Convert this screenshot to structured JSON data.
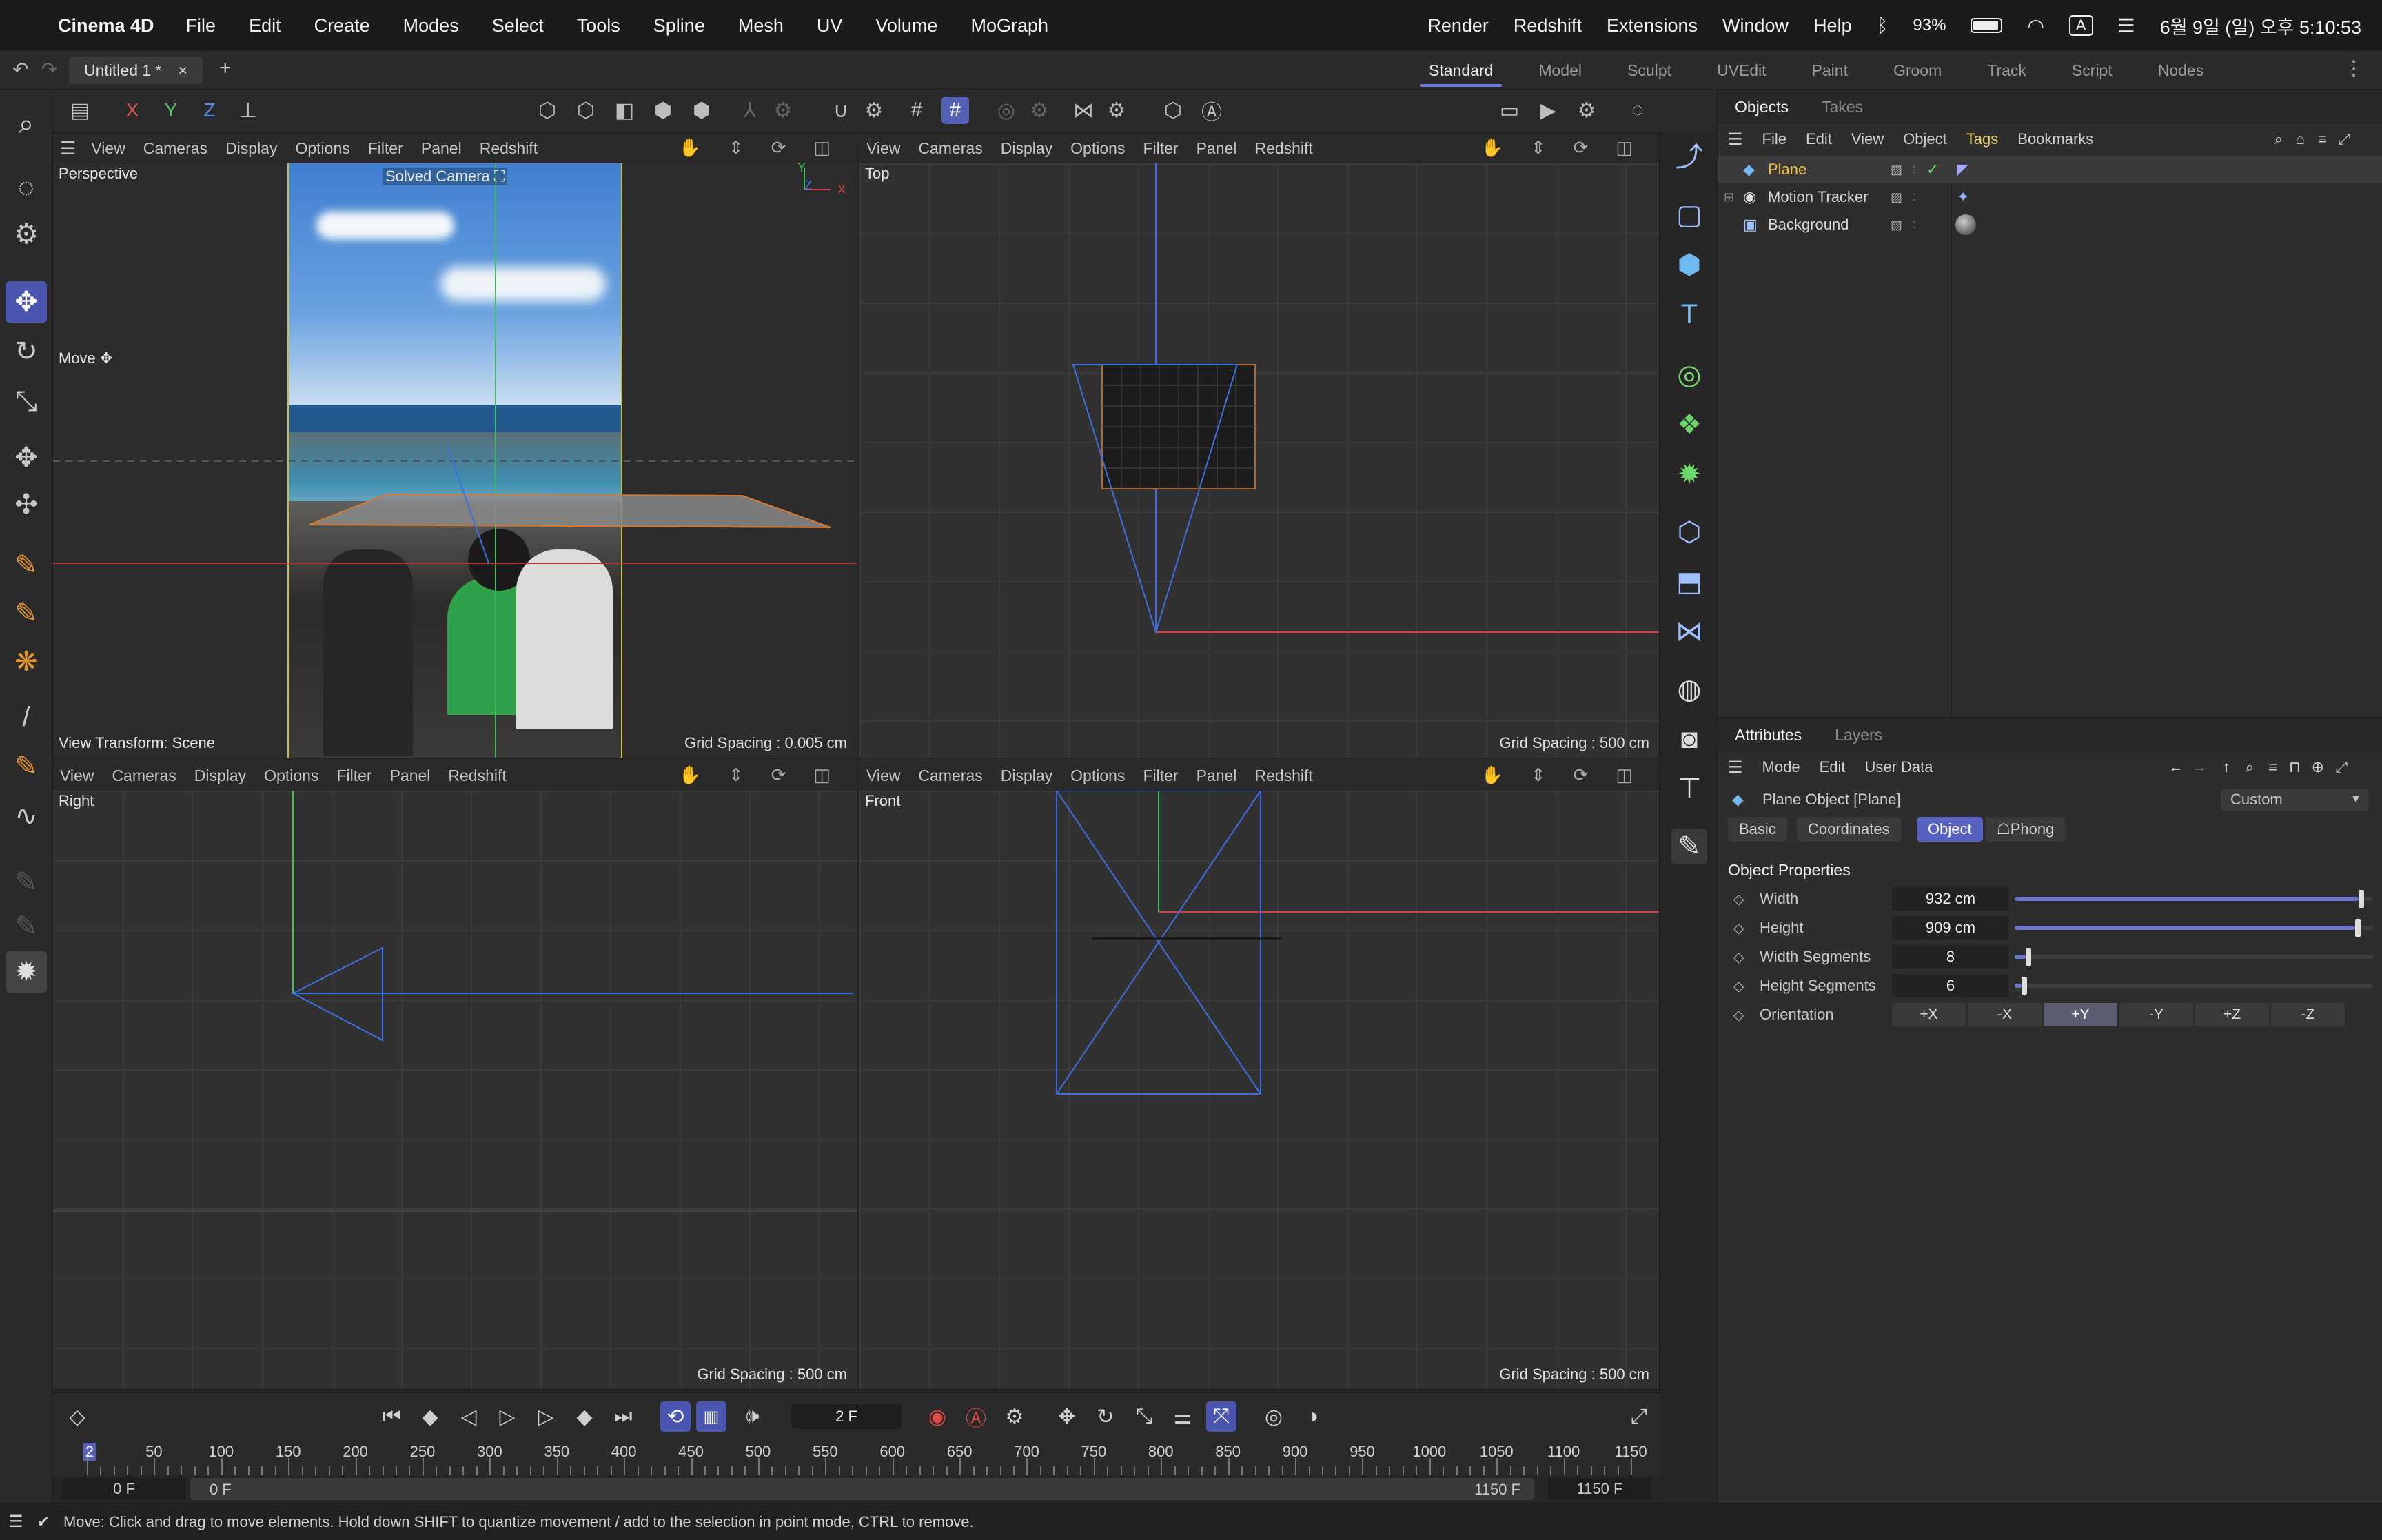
{
  "menubar": {
    "app_name": "Cinema 4D",
    "items": [
      "File",
      "Edit",
      "Create",
      "Modes",
      "Select",
      "Tools",
      "Spline",
      "Mesh",
      "UV",
      "Volume",
      "MoGraph"
    ],
    "right_items": [
      "Render",
      "Redshift",
      "Extensions",
      "Window",
      "Help"
    ],
    "battery": "93%",
    "input_source": "A",
    "datetime": "6월 9일 (일) 오후 5:10:53"
  },
  "document": {
    "tab_title": "Untitled 1 *",
    "close": "×",
    "new_tab": "+"
  },
  "layouts": {
    "items": [
      "Standard",
      "Model",
      "Sculpt",
      "UVEdit",
      "Paint",
      "Groom",
      "Track",
      "Script",
      "Nodes"
    ],
    "active": "Standard"
  },
  "toolbar": {
    "axis_x": "X",
    "axis_y": "Y",
    "axis_z": "Z"
  },
  "viewport_menu": [
    "View",
    "Cameras",
    "Display",
    "Options",
    "Filter",
    "Panel",
    "Redshift"
  ],
  "viewports": {
    "perspective": {
      "name": "Perspective",
      "camera_label": "Solved Camera",
      "tool_label": "Move",
      "view_transform": "View Transform: Scene",
      "grid": "Grid Spacing : 0.005 cm"
    },
    "top": {
      "name": "Top",
      "grid": "Grid Spacing : 500 cm"
    },
    "right": {
      "name": "Right",
      "grid": "Grid Spacing : 500 cm"
    },
    "front": {
      "name": "Front",
      "grid": "Grid Spacing : 500 cm"
    }
  },
  "objects_panel": {
    "tabs": [
      "Objects",
      "Takes"
    ],
    "menu": [
      "File",
      "Edit",
      "View",
      "Object",
      "Tags",
      "Bookmarks"
    ],
    "active_menu": "Tags",
    "items": [
      {
        "name": "Plane",
        "selected": true
      },
      {
        "name": "Motion Tracker",
        "selected": false
      },
      {
        "name": "Background",
        "selected": false
      }
    ]
  },
  "attributes_panel": {
    "tabs": [
      "Attributes",
      "Layers"
    ],
    "menu": [
      "Mode",
      "Edit",
      "User Data"
    ],
    "object_title": "Plane Object [Plane]",
    "preset": "Custom",
    "sub_tabs": [
      "Basic",
      "Coordinates",
      "Object",
      "Phong"
    ],
    "active_sub_tab": "Object",
    "section_title": "Object Properties",
    "properties": [
      {
        "label": "Width",
        "value": "932 cm",
        "slider": 0.96
      },
      {
        "label": "Height",
        "value": "909 cm",
        "slider": 0.95
      },
      {
        "label": "Width Segments",
        "value": "8",
        "slider": 0.03
      },
      {
        "label": "Height Segments",
        "value": "6",
        "slider": 0.02
      }
    ],
    "orientation_label": "Orientation",
    "orientations": [
      "+X",
      "-X",
      "+Y",
      "-Y",
      "+Z",
      "-Z"
    ],
    "active_orientation": "+Y"
  },
  "timeline": {
    "current_frame": "2 F",
    "ruler_labels": [
      "2",
      "50",
      "100",
      "150",
      "200",
      "250",
      "300",
      "350",
      "400",
      "450",
      "500",
      "550",
      "600",
      "650",
      "700",
      "750",
      "800",
      "850",
      "900",
      "950",
      "1000",
      "1050",
      "1100",
      "1150"
    ],
    "start_field": "0 F",
    "preview_start": "0 F",
    "preview_end": "1150 F",
    "end_field": "1150 F"
  },
  "status": {
    "message": "Move: Click and drag to move elements. Hold down SHIFT to quantize movement / add to the selection in point mode, CTRL to remove."
  },
  "colors": {
    "accent": "#5762c0",
    "axis_x": "#d04040",
    "axis_y": "#3fbf5a",
    "axis_z": "#4a78e0",
    "camera": "#3d6fe0"
  }
}
